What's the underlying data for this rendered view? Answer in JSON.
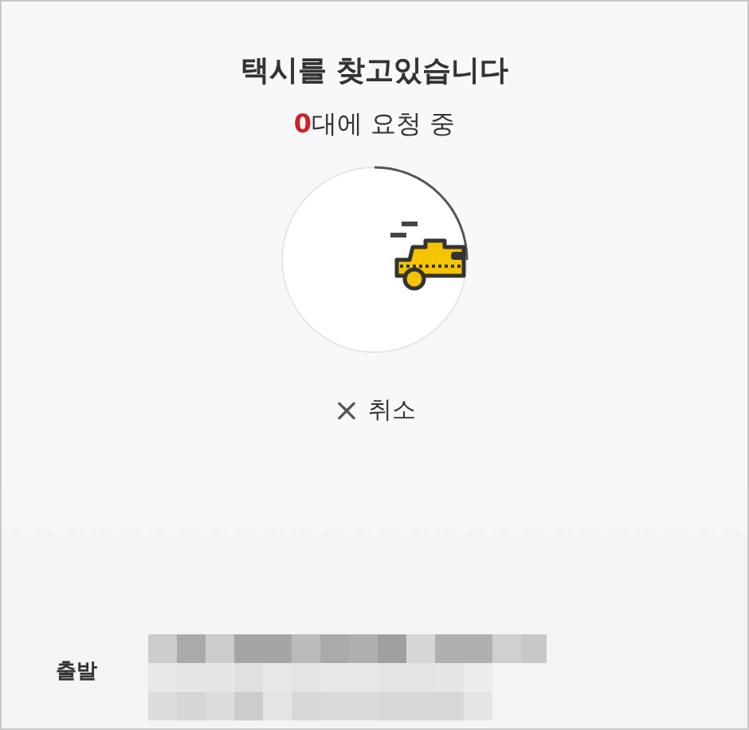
{
  "title": "택시를 찾고있습니다",
  "request_status": {
    "count": "0",
    "text": "대에 요청 중"
  },
  "search_progress": {
    "level": 0.25
  },
  "cancel_button": {
    "icon": "×",
    "label": "취소"
  },
  "route": [
    {
      "label": "출발"
    }
  ]
}
